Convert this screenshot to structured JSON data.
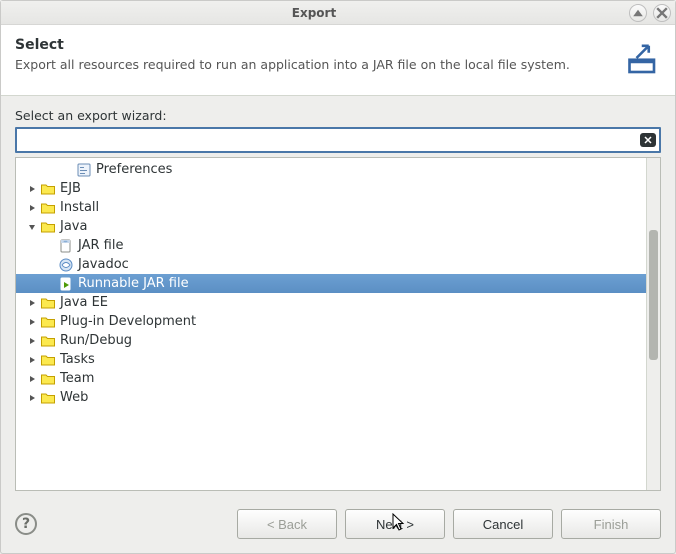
{
  "window": {
    "title": "Export"
  },
  "header": {
    "title": "Select",
    "description": "Export all resources required to run an application into a JAR file on the local file system."
  },
  "filter": {
    "label": "Select an export wizard:",
    "value": "",
    "placeholder": ""
  },
  "tree": [
    {
      "label": "Preferences",
      "depth": 2,
      "icon": "prefs",
      "expandable": false,
      "expanded": false,
      "selected": false
    },
    {
      "label": "EJB",
      "depth": 0,
      "icon": "folder",
      "expandable": true,
      "expanded": false,
      "selected": false
    },
    {
      "label": "Install",
      "depth": 0,
      "icon": "folder",
      "expandable": true,
      "expanded": false,
      "selected": false
    },
    {
      "label": "Java",
      "depth": 0,
      "icon": "folder",
      "expandable": true,
      "expanded": true,
      "selected": false
    },
    {
      "label": "JAR file",
      "depth": 1,
      "icon": "jar",
      "expandable": false,
      "expanded": false,
      "selected": false
    },
    {
      "label": "Javadoc",
      "depth": 1,
      "icon": "javadoc",
      "expandable": false,
      "expanded": false,
      "selected": false
    },
    {
      "label": "Runnable JAR file",
      "depth": 1,
      "icon": "runjar",
      "expandable": false,
      "expanded": false,
      "selected": true
    },
    {
      "label": "Java EE",
      "depth": 0,
      "icon": "folder",
      "expandable": true,
      "expanded": false,
      "selected": false
    },
    {
      "label": "Plug-in Development",
      "depth": 0,
      "icon": "folder",
      "expandable": true,
      "expanded": false,
      "selected": false
    },
    {
      "label": "Run/Debug",
      "depth": 0,
      "icon": "folder",
      "expandable": true,
      "expanded": false,
      "selected": false
    },
    {
      "label": "Tasks",
      "depth": 0,
      "icon": "folder",
      "expandable": true,
      "expanded": false,
      "selected": false
    },
    {
      "label": "Team",
      "depth": 0,
      "icon": "folder",
      "expandable": true,
      "expanded": false,
      "selected": false
    },
    {
      "label": "Web",
      "depth": 0,
      "icon": "folder",
      "expandable": true,
      "expanded": false,
      "selected": false
    }
  ],
  "buttons": {
    "back": "< Back",
    "next": "Next >",
    "cancel": "Cancel",
    "finish": "Finish"
  }
}
